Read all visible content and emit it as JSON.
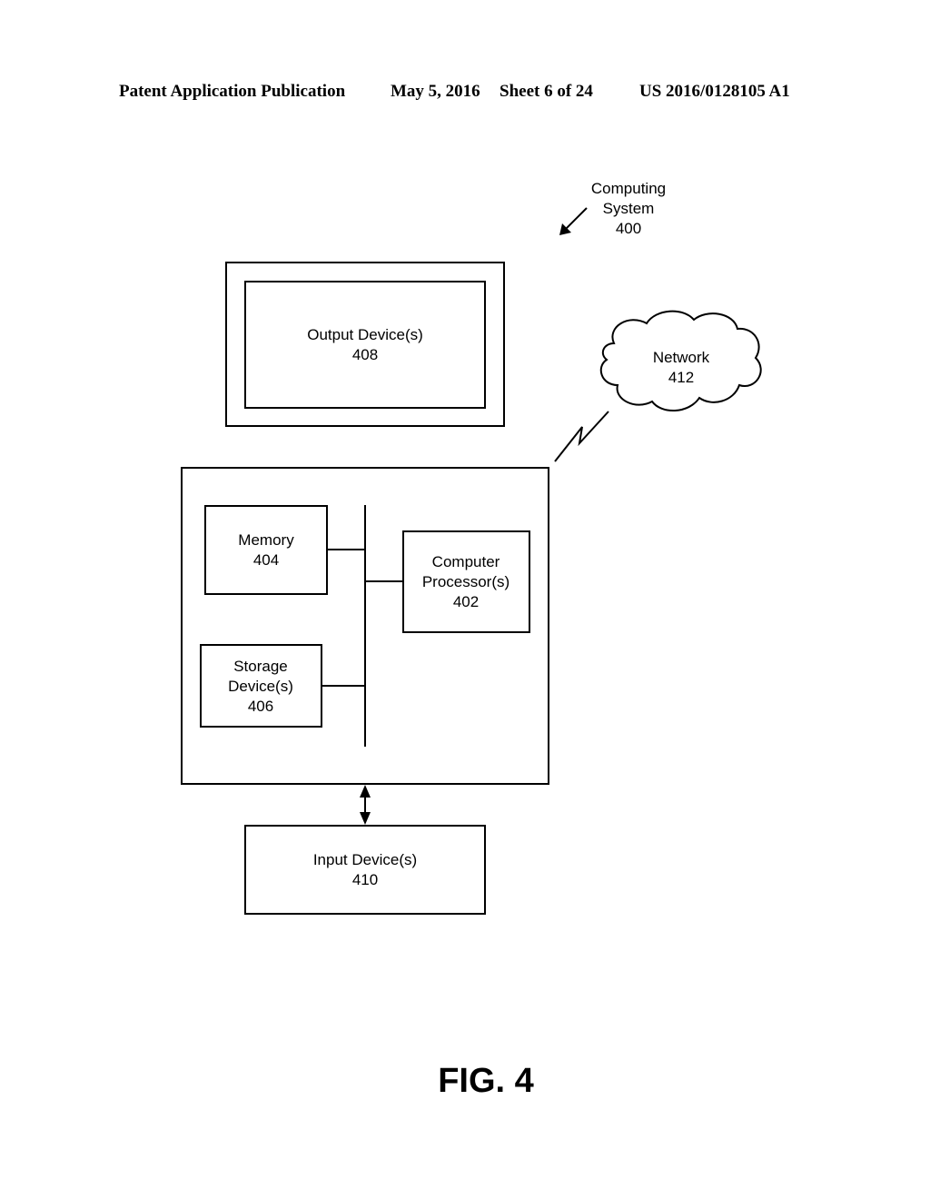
{
  "header": {
    "publication": "Patent Application Publication",
    "date": "May 5, 2016",
    "sheet": "Sheet 6 of 24",
    "number": "US 2016/0128105 A1"
  },
  "diagram": {
    "system": {
      "line1": "Computing",
      "line2": "System",
      "ref": "400"
    },
    "output_device": {
      "line1": "Output Device(s)",
      "ref": "408"
    },
    "network": {
      "line1": "Network",
      "ref": "412"
    },
    "memory": {
      "line1": "Memory",
      "ref": "404"
    },
    "processor": {
      "line1": "Computer",
      "line2": "Processor(s)",
      "ref": "402"
    },
    "storage": {
      "line1": "Storage",
      "line2": "Device(s)",
      "ref": "406"
    },
    "input_device": {
      "line1": "Input Device(s)",
      "ref": "410"
    },
    "figure_label": "FIG. 4"
  }
}
